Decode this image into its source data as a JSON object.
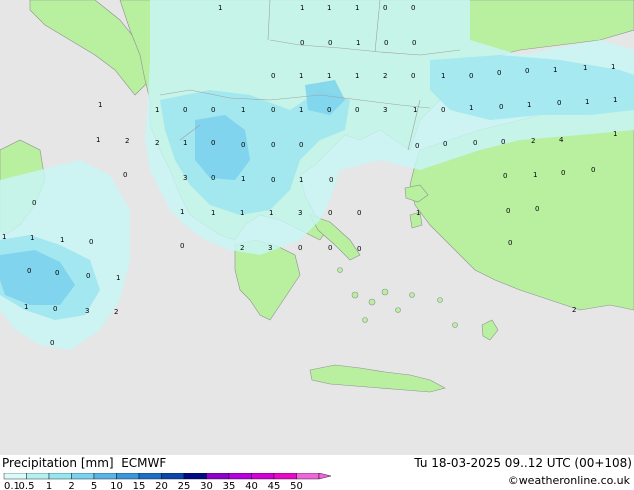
{
  "header": {
    "title": "Precipitation [mm]",
    "model": "ECMWF",
    "datetime": "Tu 18-03-2025 09..12 UTC (00+108)"
  },
  "footer": {
    "credit": "©weatheronline.co.uk"
  },
  "legend": {
    "stops": [
      "0.1",
      "0.5",
      "1",
      "2",
      "5",
      "10",
      "15",
      "20",
      "25",
      "30",
      "35",
      "40",
      "45",
      "50"
    ],
    "colors": [
      "#d9fafa",
      "#b4f0f0",
      "#96e6f0",
      "#78d2f0",
      "#5ab4e6",
      "#3c96dc",
      "#1e6ec8",
      "#0a46aa",
      "#000a82",
      "#8c00c8",
      "#b400dc",
      "#d200d2",
      "#e60ac8",
      "#f064dc"
    ]
  },
  "map_colors": {
    "sea": "#e6e6e6",
    "land": "#b8f0a0",
    "precip_light": "#c8f5f5",
    "precip_medium": "#9ee6f0",
    "precip_heavy": "#7dd2ec",
    "border": "#a0a0a0"
  },
  "map_labels": [
    "1",
    "1",
    "1",
    "1",
    "0",
    "0",
    "0",
    "0",
    "1",
    "0",
    "0",
    "0",
    "1",
    "1",
    "1",
    "2",
    "0",
    "1",
    "0",
    "0",
    "0",
    "1",
    "1",
    "1",
    "1",
    "1",
    "0",
    "0",
    "1",
    "0",
    "1",
    "0",
    "0",
    "3",
    "1",
    "0",
    "1",
    "0",
    "1",
    "0",
    "1",
    "1",
    "1",
    "2",
    "2",
    "1",
    "0",
    "0",
    "0",
    "0",
    "0",
    "0",
    "0",
    "0",
    "2",
    "4",
    "1",
    "0",
    "3",
    "0",
    "1",
    "0",
    "1",
    "0",
    "0",
    "1",
    "0",
    "0",
    "0",
    "1",
    "1",
    "1",
    "1",
    "3",
    "0",
    "0",
    "1",
    "0",
    "0",
    "1",
    "1",
    "1",
    "0",
    "0",
    "2",
    "3",
    "0",
    "0",
    "0",
    "0",
    "0",
    "0",
    "0",
    "1",
    "1",
    "0",
    "3",
    "2",
    "2",
    "0",
    "2",
    "2",
    "0",
    "0",
    "0",
    "0"
  ]
}
